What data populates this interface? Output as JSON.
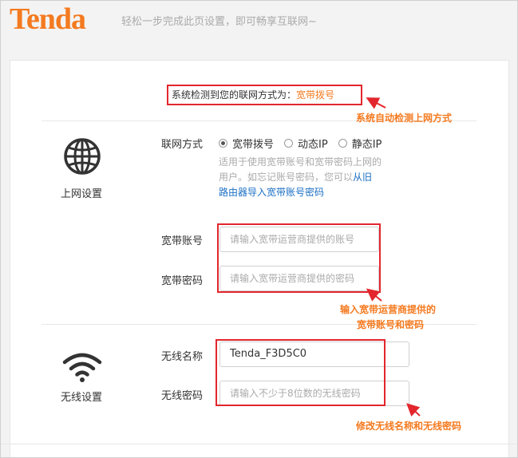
{
  "header": {
    "logo": "Tenda",
    "slogan": "轻松一步完成此页设置，即可畅享互联网~"
  },
  "detect": {
    "prefix": "系统检测到您的联网方式为：",
    "value": "宽带拨号"
  },
  "internet": {
    "section_title": "上网设置",
    "mode_label": "联网方式",
    "modes": [
      "宽带拨号",
      "动态IP",
      "静态IP"
    ],
    "selected_mode": "宽带拨号",
    "help_text": "适用于使用宽带账号和宽带密码上网的用户。如忘记账号密码，您可以",
    "help_link": "从旧路由器导入宽带账号密码",
    "account_label": "宽带账号",
    "account_placeholder": "请输入宽带运营商提供的账号",
    "password_label": "宽带密码",
    "password_placeholder": "请输入宽带运营商提供的密码"
  },
  "wireless": {
    "section_title": "无线设置",
    "ssid_label": "无线名称",
    "ssid_value": "Tenda_F3D5C0",
    "wifi_password_label": "无线密码",
    "wifi_password_placeholder": "请输入不少于8位数的无线密码"
  },
  "annotations": {
    "auto_detect": "系统自动检测上网方式",
    "isp_line1": "输入宽带运营商提供的",
    "isp_line2": "宽带账号和密码",
    "wireless": "修改无线名称和无线密码"
  },
  "colors": {
    "brand_orange": "#f47a20",
    "annotation_red": "#e3262d",
    "link_blue": "#1a6fc4"
  }
}
